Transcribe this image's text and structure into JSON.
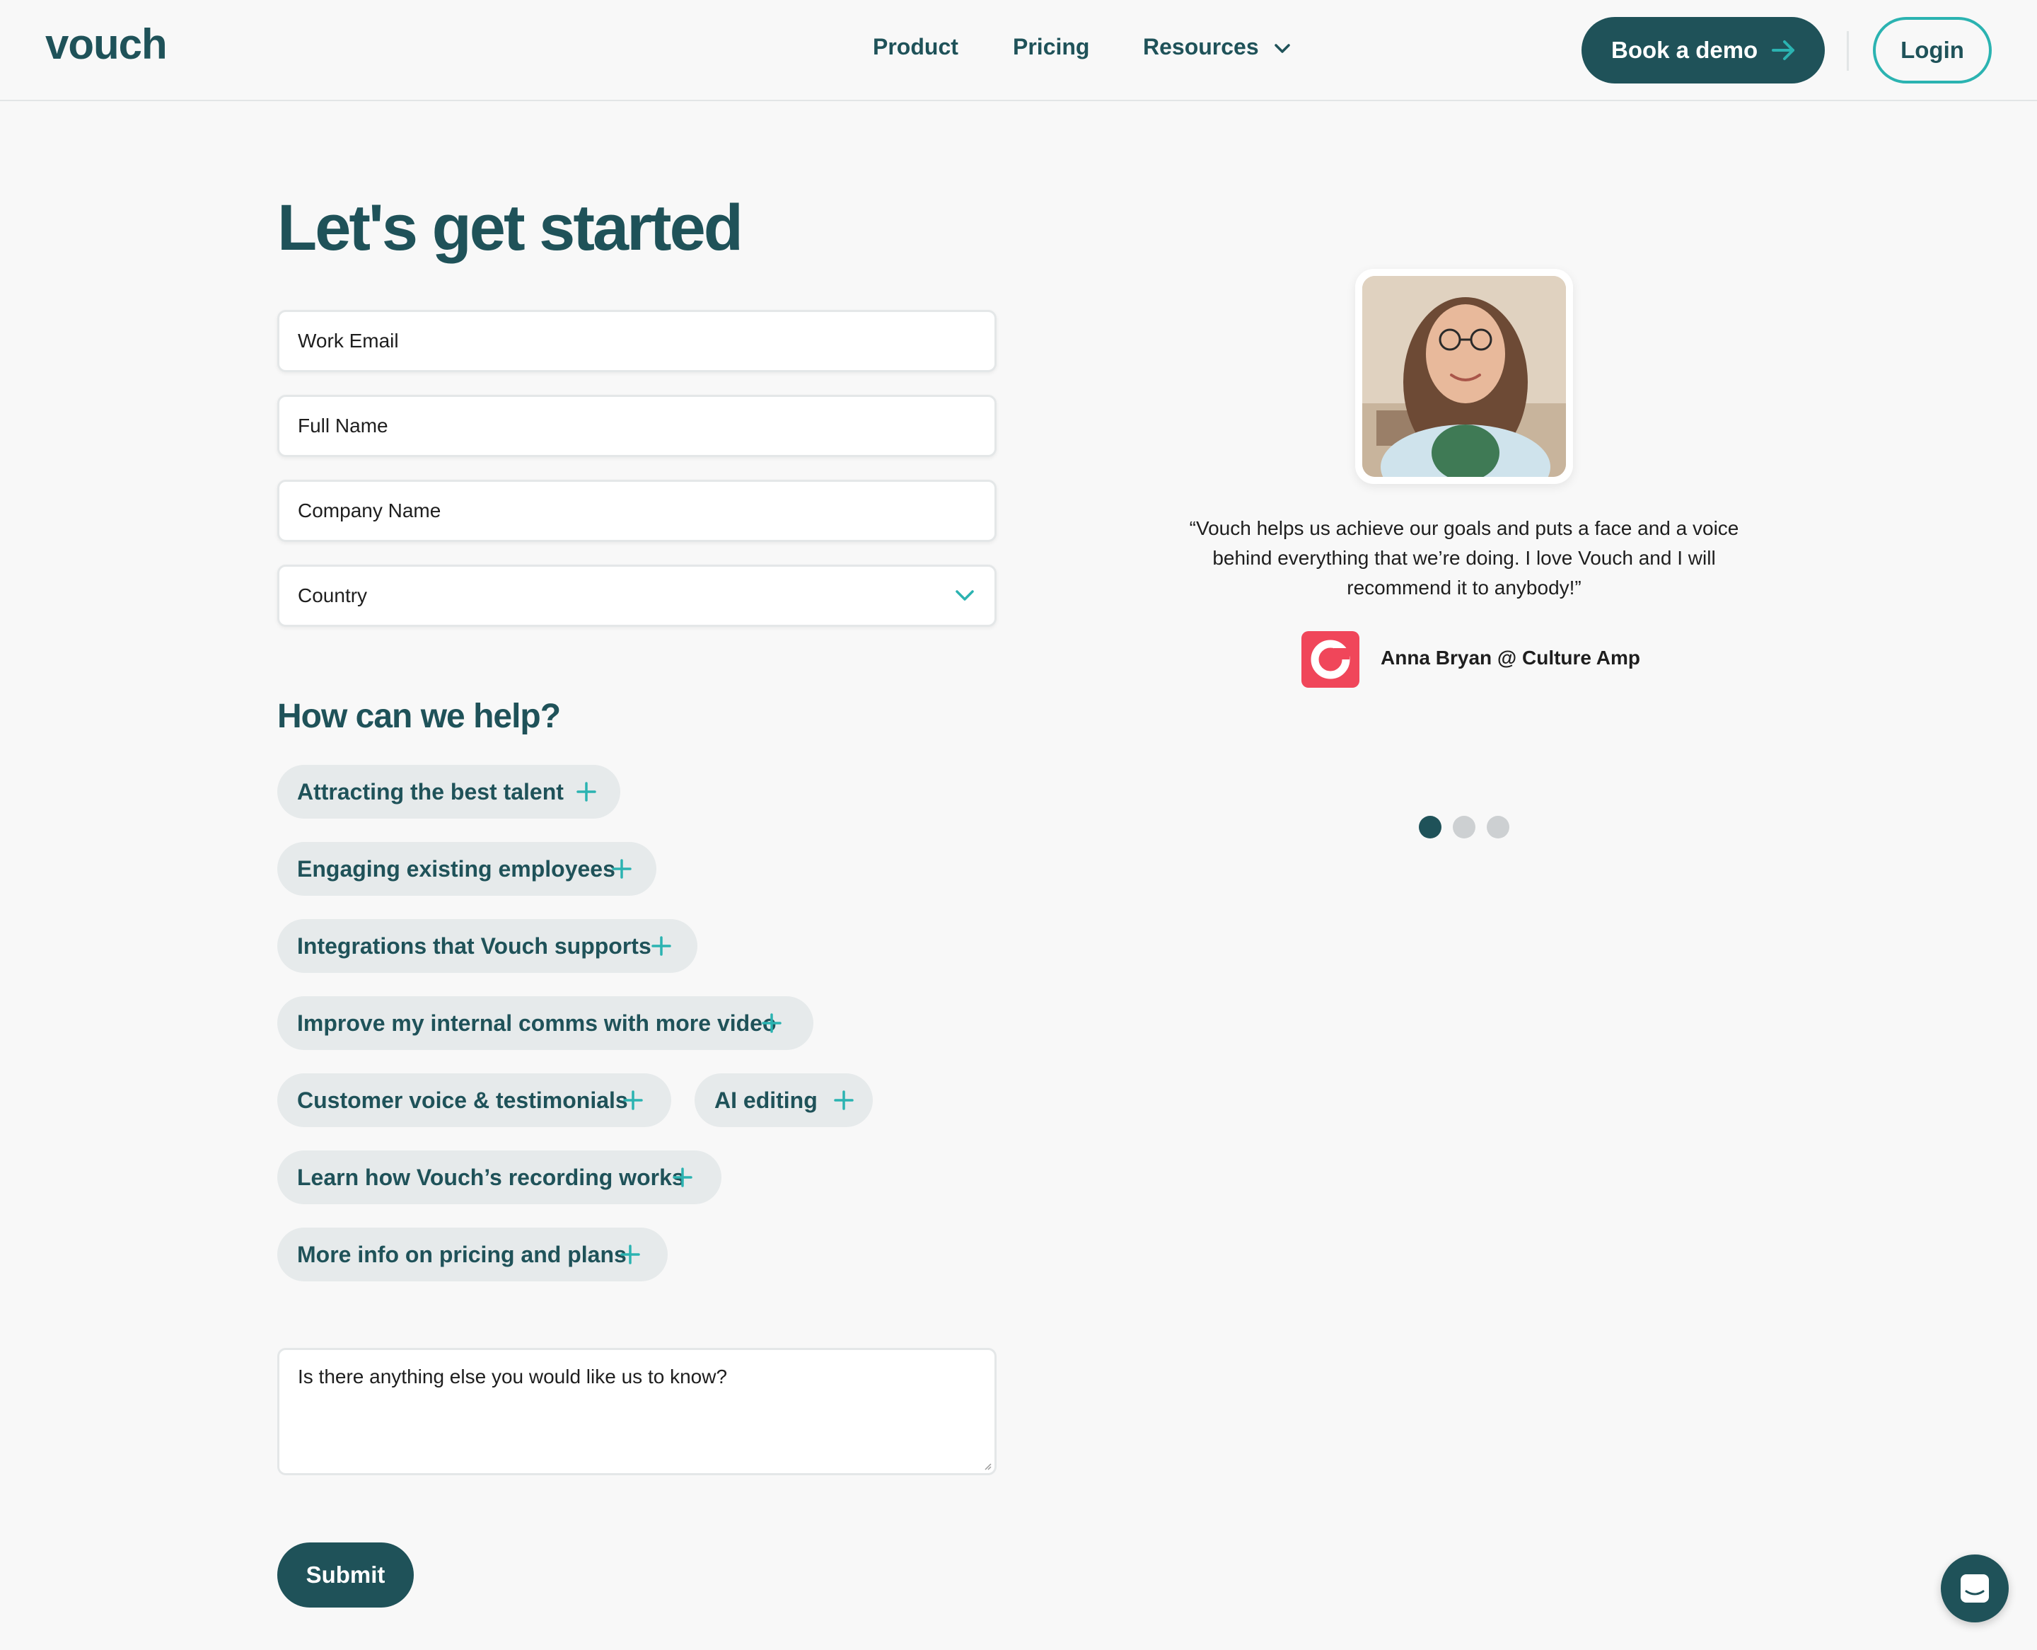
{
  "header": {
    "logo": "vouch",
    "nav": [
      "Product",
      "Pricing",
      "Resources"
    ],
    "book_demo": "Book a demo",
    "login": "Login"
  },
  "form": {
    "title": "Let's get started",
    "work_email_placeholder": "Work Email",
    "full_name_placeholder": "Full Name",
    "company_placeholder": "Company Name",
    "country_label": "Country",
    "help_title": "How can we help?",
    "options": [
      "Attracting the best talent",
      "Engaging existing employees",
      "Integrations that Vouch supports",
      "Improve my internal comms with more video",
      "Customer voice & testimonials",
      "AI editing",
      "Learn how Vouch’s recording works",
      "More info on pricing and plans"
    ],
    "message_placeholder": "Is there anything else you would like us to know?",
    "submit": "Submit"
  },
  "testimonial": {
    "quote": "“Vouch helps us achieve our goals and puts a face and a voice behind everything that we’re doing. I love Vouch and I will recommend it to anybody!”",
    "author": "Anna Bryan @ Culture Amp",
    "active_slide": 1,
    "slide_count": 3
  },
  "colors": {
    "primary": "#1f5259",
    "accent": "#2bb3b1",
    "chip_bg": "#e6eaeb",
    "brand_icon": "#f0465a",
    "background": "#f8f8f8"
  },
  "icons": [
    "chevron-down-icon",
    "arrow-right-icon",
    "plus-icon",
    "culture-amp-logo-icon",
    "chat-icon"
  ]
}
